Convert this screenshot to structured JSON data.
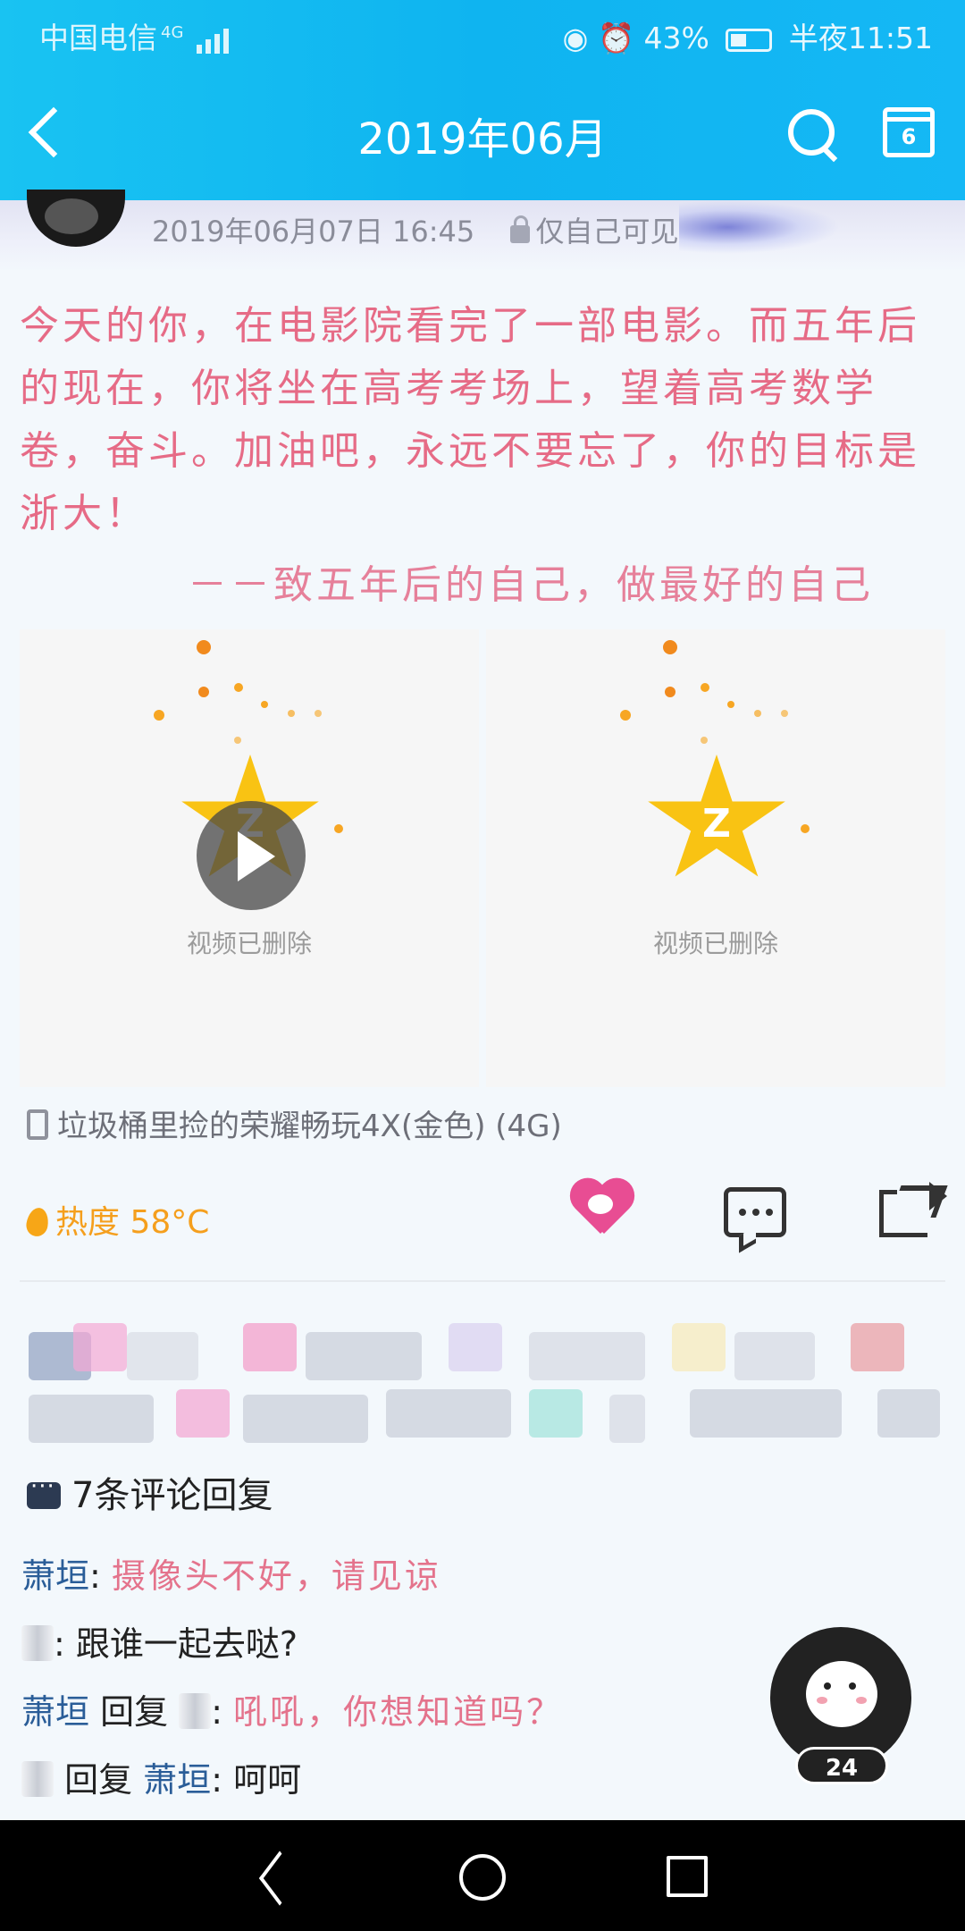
{
  "status_bar": {
    "carrier": "中国电信",
    "network": "4G",
    "battery": "43%",
    "time": "半夜11:51"
  },
  "header": {
    "title": "2019年06月",
    "calendar_day": "6",
    "icons": [
      "back-icon",
      "search-icon",
      "calendar-icon"
    ]
  },
  "post": {
    "timestamp": "2019年06月07日 16:45",
    "visibility": "仅自己可见",
    "body": "今天的你，在电影院看完了一部电影。而五年后的现在，你将坐在高考考场上，望着高考数学卷，奋斗。加油吧，永远不要忘了，你的目标是浙大！",
    "signature": "－－致五年后的自己，做最好的自己",
    "videos": [
      {
        "status": "视频已删除"
      },
      {
        "status": "视频已删除"
      }
    ],
    "device": "垃圾桶里捡的荣耀畅玩4X(金色) (4G)",
    "heat_label": "热度 58°C"
  },
  "comments": {
    "header": "7条评论回复",
    "items": [
      {
        "author": "萧垣",
        "separator": ": ",
        "text": "摄像头不好，请见谅"
      },
      {
        "text": ": 跟谁一起去哒?"
      },
      {
        "author": "萧垣",
        "reply_word": " 回复 ",
        "separator": ": ",
        "text": "吼吼，你想知道吗？"
      },
      {
        "reply_word": " 回复 ",
        "target": "萧垣",
        "separator": ": ",
        "text": "呵呵"
      }
    ]
  },
  "mascot": {
    "count": "24"
  },
  "colors": {
    "header_bg": "#15b8f5",
    "handwriting": "#e66b86",
    "heat": "#f59f1d",
    "like": "#e84d93",
    "name_link": "#2a5d98"
  }
}
